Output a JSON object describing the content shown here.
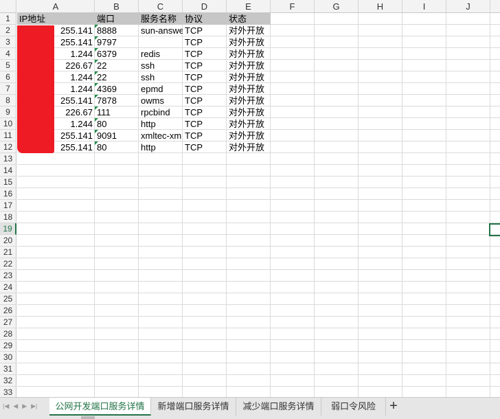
{
  "columns": [
    "A",
    "B",
    "C",
    "D",
    "E",
    "F",
    "G",
    "H",
    "I",
    "J"
  ],
  "row_numbers": [
    "1",
    "2",
    "3",
    "4",
    "5",
    "6",
    "7",
    "8",
    "9",
    "10",
    "11",
    "12",
    "13",
    "14",
    "15",
    "16",
    "17",
    "18",
    "19",
    "20",
    "21",
    "22",
    "23",
    "24",
    "25",
    "26",
    "27",
    "28",
    "29",
    "30",
    "31",
    "32",
    "33"
  ],
  "selected_row": "19",
  "header_row": [
    "IP地址",
    "端口",
    "服务名称",
    "协议",
    "状态"
  ],
  "rows": [
    {
      "ip": "255.141",
      "port": "8888",
      "service": "sun-answe",
      "protocol": "TCP",
      "status": "对外开放"
    },
    {
      "ip": "255.141",
      "port": "9797",
      "service": "",
      "protocol": "TCP",
      "status": "对外开放"
    },
    {
      "ip": "1.244",
      "port": "6379",
      "service": "redis",
      "protocol": "TCP",
      "status": "对外开放"
    },
    {
      "ip": "226.67",
      "port": "22",
      "service": "ssh",
      "protocol": "TCP",
      "status": "对外开放"
    },
    {
      "ip": "1.244",
      "port": "22",
      "service": "ssh",
      "protocol": "TCP",
      "status": "对外开放"
    },
    {
      "ip": "1.244",
      "port": "4369",
      "service": "epmd",
      "protocol": "TCP",
      "status": "对外开放"
    },
    {
      "ip": "255.141",
      "port": "7878",
      "service": "owms",
      "protocol": "TCP",
      "status": "对外开放"
    },
    {
      "ip": "226.67",
      "port": "111",
      "service": "rpcbind",
      "protocol": "TCP",
      "status": "对外开放"
    },
    {
      "ip": "1.244",
      "port": "80",
      "service": "http",
      "protocol": "TCP",
      "status": "对外开放"
    },
    {
      "ip": "255.141",
      "port": "9091",
      "service": "xmltec-xm",
      "protocol": "TCP",
      "status": "对外开放"
    },
    {
      "ip": "255.141",
      "port": "80",
      "service": "http",
      "protocol": "TCP",
      "status": "对外开放"
    }
  ],
  "sheet_tabs": [
    "公网开发端口服务详情",
    "新增端口服务详情",
    "减少端口服务详情",
    "弱口令风险"
  ],
  "active_tab": 0,
  "add_tab_label": "+",
  "colors": {
    "accent": "#217346",
    "redaction": "#ee1b24",
    "header_fill": "#c6c6c6"
  }
}
